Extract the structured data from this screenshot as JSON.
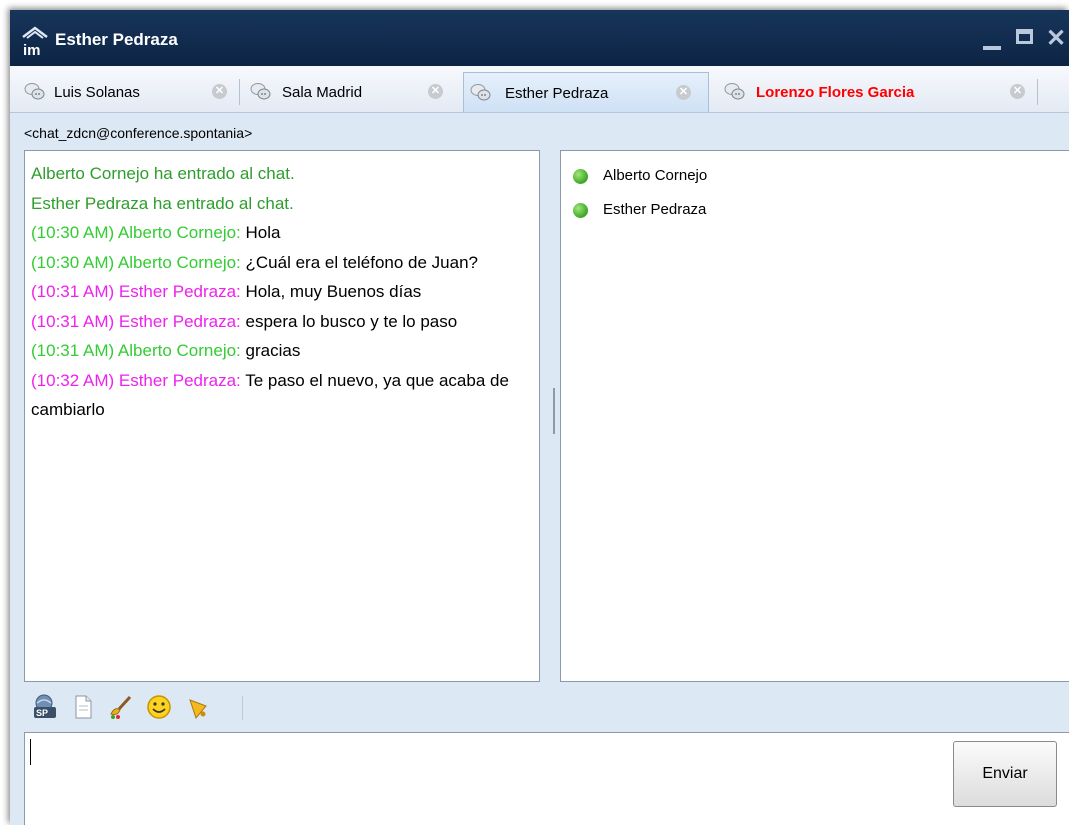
{
  "window": {
    "title": "Esther Pedraza",
    "logo_icon": "im-logo-icon"
  },
  "tabs": [
    {
      "label": "Luis Solanas",
      "active": false,
      "alert": false
    },
    {
      "label": "Sala Madrid",
      "active": false,
      "alert": false
    },
    {
      "label": "Esther Pedraza",
      "active": true,
      "alert": false
    },
    {
      "label": "Lorenzo Flores Garcia",
      "active": false,
      "alert": true
    }
  ],
  "room": {
    "address": "<chat_zdcn@conference.spontania>"
  },
  "chat": {
    "system": [
      "Alberto Cornejo ha entrado al chat.",
      "Esther Pedraza ha entrado al chat."
    ],
    "messages": [
      {
        "meta": "(10:30 AM) Alberto Cornejo:",
        "text": "Hola",
        "color": "#33cc33"
      },
      {
        "meta": "(10:30 AM) Alberto Cornejo:",
        "text": "¿Cuál era el teléfono de Juan?",
        "color": "#33cc33"
      },
      {
        "meta": "(10:31 AM) Esther Pedraza:",
        "text": "Hola, muy Buenos días",
        "color": "#ee22ee"
      },
      {
        "meta": "(10:31 AM) Esther Pedraza:",
        "text": "espera lo busco y te lo paso",
        "color": "#ee22ee"
      },
      {
        "meta": "(10:31 AM) Alberto Cornejo:",
        "text": "gracias",
        "color": "#33cc33"
      },
      {
        "meta": "(10:32 AM) Esther Pedraza:",
        "text": "Te paso el nuevo, ya que acaba de cambiarlo",
        "color": "#ee22ee"
      }
    ]
  },
  "participants": [
    {
      "name": "Alberto Cornejo",
      "status": "online"
    },
    {
      "name": "Esther Pedraza",
      "status": "online"
    }
  ],
  "toolbar": {
    "icons": [
      "sp-share-icon",
      "file-icon",
      "paint-brush-icon",
      "smiley-icon",
      "bell-icon"
    ]
  },
  "input": {
    "value": "",
    "send_label": "Enviar"
  },
  "colors": {
    "title_bar": "#0d2444",
    "alert_tab": "#ff0000",
    "online": "#3aa522"
  }
}
